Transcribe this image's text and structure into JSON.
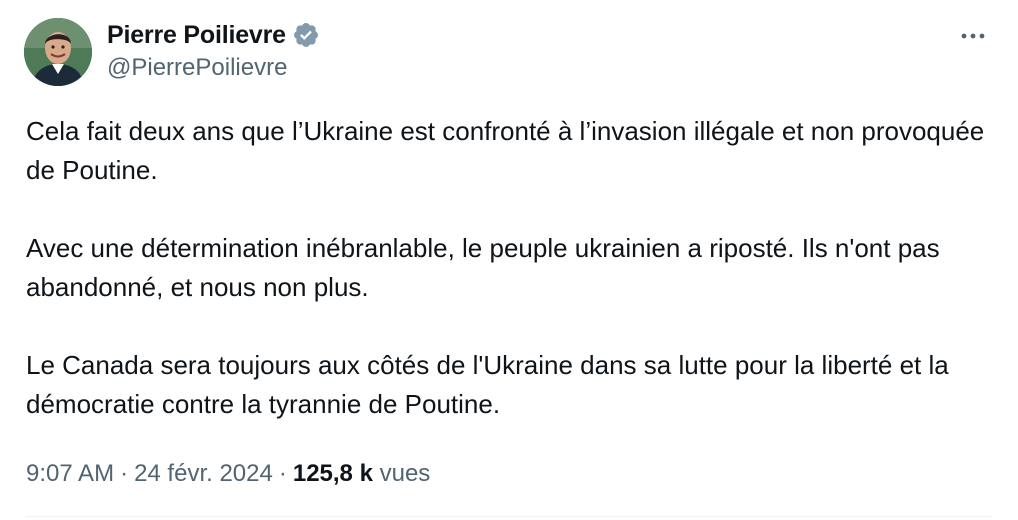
{
  "author": {
    "name": "Pierre Poilievre",
    "handle": "@PierrePoilievre",
    "verified_icon": "verified-badge-icon",
    "avatar_icon": "avatar"
  },
  "menu": {
    "icon": "more-icon"
  },
  "tweet": {
    "paragraphs": [
      "Cela fait deux ans que l’Ukraine est confronté à l’invasion illégale et non provoquée de Poutine.",
      "Avec une détermination inébranlable, le peuple ukrainien a riposté. Ils n'ont pas abandonné, et nous non plus.",
      "Le Canada sera toujours aux côtés de l'Ukraine dans sa lutte pour la liberté et la démocratie contre la tyrannie de Poutine."
    ]
  },
  "meta": {
    "time": "9:07 AM",
    "separator": "·",
    "date": "24 févr. 2024",
    "views_count": "125,8 k",
    "views_label": "vues"
  },
  "colors": {
    "text_primary": "#0f1419",
    "text_secondary": "#536471",
    "verified_badge": "#829aab",
    "divider": "#eff3f4"
  }
}
